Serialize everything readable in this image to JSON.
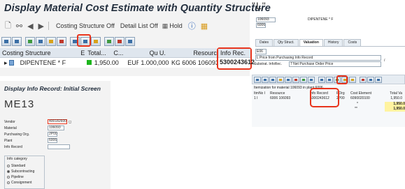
{
  "main": {
    "title": "Display Material Cost Estimate with Quantity Structure",
    "toolbar": {
      "costing_structure_off": "Costing Structure Off",
      "detail_list_off": "Detail List Off",
      "hold": "Hold"
    },
    "grid": {
      "columns": [
        "Costing Structure",
        "E.",
        "Total...",
        "C...",
        "Quantity",
        "U.",
        "Resource"
      ],
      "row": {
        "structure": "DIPENTENE * F",
        "total": "1,950.00",
        "currency": "EUR",
        "quantity": "1.000,000",
        "unit": "KG",
        "resource": "6006 106093"
      }
    },
    "info_rec": {
      "header": "Info Rec.",
      "value": "5300243612"
    }
  },
  "info_panel": {
    "title": "Display Info Record: Initial Screen",
    "tcode": "ME13",
    "fields": [
      {
        "label": "Vendor",
        "value": "400182600"
      },
      {
        "label": "Material",
        "value": "106093"
      },
      {
        "label": "Purchasing Org.",
        "value": "2P00"
      },
      {
        "label": "Plant",
        "value": "6006"
      },
      {
        "label": "Info Record",
        "value": ""
      }
    ],
    "category": {
      "title": "Info category",
      "options": [
        "Standard",
        "Subcontracting",
        "Pipeline",
        "Consignment"
      ],
      "selected_index": 1
    }
  },
  "right": {
    "quote_mark": "\"L\"",
    "material": "106093",
    "material_desc": "DIPENTENE * F",
    "plant": "6006",
    "tabs": [
      "Dates",
      "Qty Struct.",
      "Valuation",
      "History",
      "Costs"
    ],
    "active_tab": "Valuation",
    "valuation": {
      "code": "E06",
      "strategy": "L Price from Purchasing Info Record",
      "substrat_label": "Substrat. InfoRec.",
      "substrat": "7 Net Purchase Order Price",
      "slash": "/"
    },
    "itemization": {
      "caption": "Itemization for material 106093 in plant 6006",
      "columns": [
        "ItmNo",
        "I",
        "Resource",
        "Info Record",
        "POrg",
        "Cost Element",
        "Total Va"
      ],
      "row": [
        "1",
        "I",
        "6006 106093",
        "5300243612",
        "2P00",
        "6090020100",
        "1,950.0"
      ],
      "total1": "1,950.0",
      "total2": "1,950.0",
      "dots1": "*",
      "dots2": "**"
    }
  }
}
